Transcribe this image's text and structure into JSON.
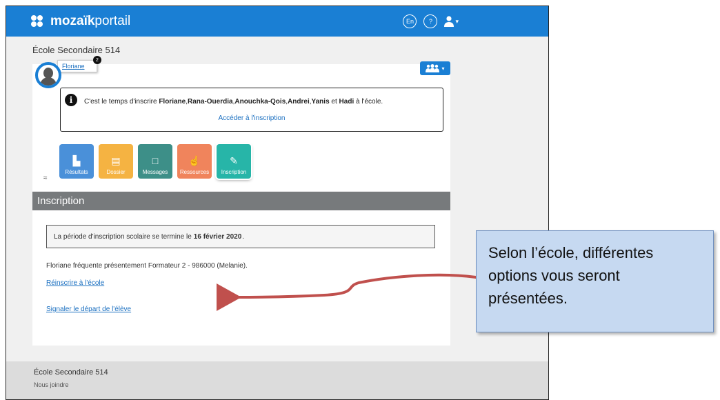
{
  "header": {
    "logo_bold": "mozaïk",
    "logo_light": "portail",
    "lang_label": "En",
    "help_label": "?",
    "user_menu_chevron": "▾",
    "brand_color": "#1a7fd4"
  },
  "school_name": "École Secondaire 514",
  "student": {
    "name": "Floriane",
    "badge": "2"
  },
  "group_button": "▾",
  "notice": {
    "text_prefix": "C'est le temps d'inscrire",
    "names": [
      {
        "text": "Floriane",
        "bold": true
      },
      {
        "text": ",",
        "bold": false
      },
      {
        "text": "Rana-Ouerdia",
        "bold": true
      },
      {
        "text": ",",
        "bold": false
      },
      {
        "text": "Anouchka-Qois",
        "bold": true
      },
      {
        "text": ",",
        "bold": false
      },
      {
        "text": "Andrei",
        "bold": true
      },
      {
        "text": ",",
        "bold": false
      },
      {
        "text": "Yanis",
        "bold": true
      },
      {
        "text": "et",
        "bold": false
      },
      {
        "text": "Hadi",
        "bold": true
      }
    ],
    "text_suffix": "à l'école.",
    "link": "Accéder à l'inscription"
  },
  "tiles": [
    {
      "label": "Résultats",
      "icon": "bar-chart-icon",
      "color": "#4a90d9"
    },
    {
      "label": "Dossier",
      "icon": "folder-icon",
      "color": "#f5b342"
    },
    {
      "label": "Messages",
      "icon": "note-icon",
      "color": "#3d8f88"
    },
    {
      "label": "Ressources",
      "icon": "hand-pointer-icon",
      "color": "#f0845c"
    },
    {
      "label": "Inscription",
      "icon": "form-edit-icon",
      "color": "#27b5a8"
    }
  ],
  "section": {
    "title": "Inscription",
    "period_prefix": "La période d'inscription scolaire se termine le",
    "period_date": "16 février 2020",
    "period_suffix": ".",
    "attendance": "Floriane fréquente présentement Formateur 2 - 986000 (Melanie).",
    "reenroll_link": "Réinscrire à l'école",
    "departure_link": "Signaler le départ de l'élève"
  },
  "footer": {
    "school": "École Secondaire 514",
    "contact": "Nous joindre"
  },
  "callout": {
    "lines": [
      "Selon l’école, différentes",
      "options vous seront",
      "présentées."
    ],
    "fill": "#c6d9f1",
    "arrow_color": "#c0504d"
  }
}
